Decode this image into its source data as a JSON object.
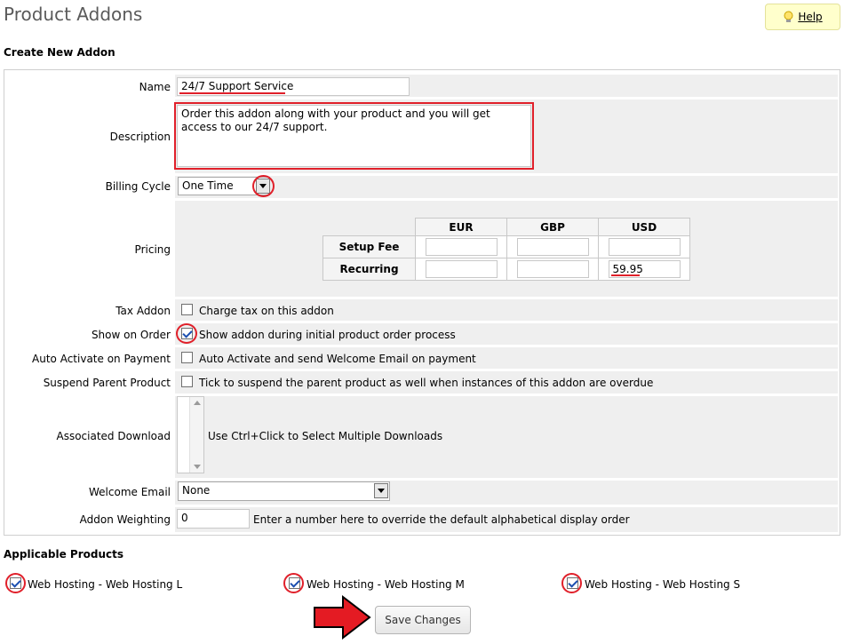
{
  "page": {
    "title": "Product Addons",
    "help_label": "Help"
  },
  "create_section": {
    "heading": "Create New Addon"
  },
  "form": {
    "name_label": "Name",
    "name_value": "24/7 Support Service",
    "description_label": "Description",
    "description_value": "Order this addon along with your product and you will get access to our 24/7 support.",
    "billing_cycle_label": "Billing Cycle",
    "billing_cycle_value": "One Time",
    "pricing_label": "Pricing",
    "pricing": {
      "currencies": [
        "EUR",
        "GBP",
        "USD"
      ],
      "rows": [
        {
          "label": "Setup Fee",
          "values": [
            "",
            "",
            ""
          ]
        },
        {
          "label": "Recurring",
          "values": [
            "",
            "",
            "59.95"
          ]
        }
      ]
    },
    "tax_addon_label": "Tax Addon",
    "tax_addon_text": "Charge tax on this addon",
    "tax_addon_checked": false,
    "show_on_order_label": "Show on Order",
    "show_on_order_text": "Show addon during initial product order process",
    "show_on_order_checked": true,
    "auto_activate_label": "Auto Activate on Payment",
    "auto_activate_text": "Auto Activate and send Welcome Email on payment",
    "auto_activate_checked": false,
    "suspend_parent_label": "Suspend Parent Product",
    "suspend_parent_text": "Tick to suspend the parent product as well when instances of this addon are overdue",
    "suspend_parent_checked": false,
    "associated_download_label": "Associated Download",
    "associated_download_hint": "Use Ctrl+Click to Select Multiple Downloads",
    "welcome_email_label": "Welcome Email",
    "welcome_email_value": "None",
    "addon_weighting_label": "Addon Weighting",
    "addon_weighting_value": "0",
    "addon_weighting_hint": "Enter a number here to override the default alphabetical display order"
  },
  "applicable": {
    "heading": "Applicable Products",
    "products": [
      {
        "label": "Web Hosting - Web Hosting L",
        "checked": true
      },
      {
        "label": "Web Hosting - Web Hosting M",
        "checked": true
      },
      {
        "label": "Web Hosting - Web Hosting S",
        "checked": true
      }
    ]
  },
  "actions": {
    "save_label": "Save Changes"
  },
  "colors": {
    "annotation": "#e0202a",
    "row_background": "#efefef",
    "help_background": "#ffffcc"
  },
  "icons": [
    "lightbulb-icon",
    "chevron-down-icon",
    "red-arrow-icon"
  ]
}
